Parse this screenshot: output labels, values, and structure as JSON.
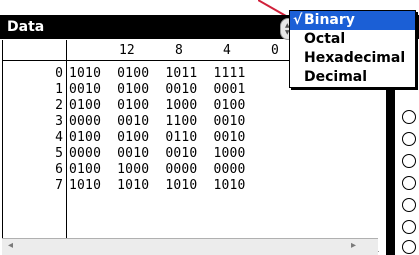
{
  "title": "Data",
  "columns": [
    "12",
    "8",
    "4",
    "0"
  ],
  "rows": [
    {
      "index": "0",
      "value": "1010  0100  1011  1111"
    },
    {
      "index": "1",
      "value": "0010  0100  0010  0001"
    },
    {
      "index": "2",
      "value": "0100  0100  1000  0100"
    },
    {
      "index": "3",
      "value": "0000  0010  1100  0010"
    },
    {
      "index": "4",
      "value": "0100  0100  0110  0010"
    },
    {
      "index": "5",
      "value": "0000  0010  0010  1000"
    },
    {
      "index": "6",
      "value": "0100  1000  0000  0000"
    },
    {
      "index": "7",
      "value": "1010  1010  1010  1010"
    }
  ],
  "menu": {
    "checkmark": "√",
    "items": [
      "Binary",
      "Octal",
      "Hexadecimal",
      "Decimal"
    ],
    "selected": "Binary"
  },
  "scroll": {
    "left_arrow": "◂",
    "right_arrow": "▸"
  },
  "spinner": {
    "up": "▲",
    "down": "▼"
  },
  "colors": {
    "selection": "#1b5fd6",
    "pointer_line": "#d0203a"
  }
}
